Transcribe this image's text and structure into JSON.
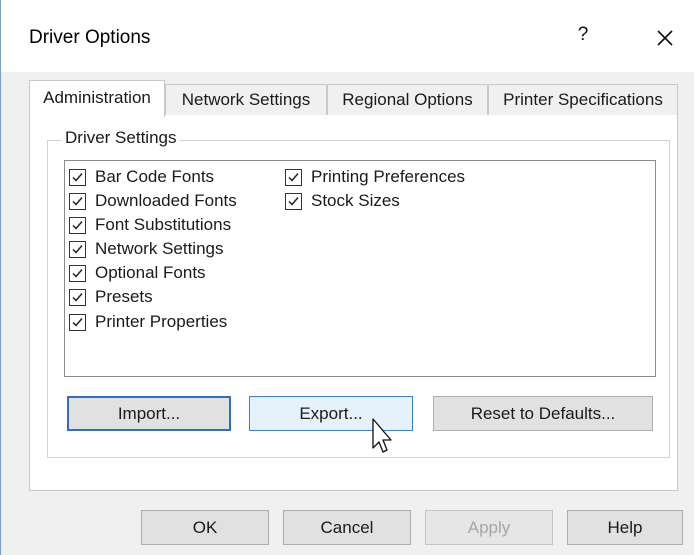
{
  "window": {
    "title": "Driver Options",
    "help_glyph": "?"
  },
  "tabs": [
    {
      "label": "Administration",
      "active": true
    },
    {
      "label": "Network Settings",
      "active": false
    },
    {
      "label": "Regional Options",
      "active": false
    },
    {
      "label": "Printer Specifications",
      "active": false
    }
  ],
  "driver_settings": {
    "label": "Driver Settings",
    "items": [
      {
        "label": "Bar Code Fonts",
        "checked": true
      },
      {
        "label": "Downloaded Fonts",
        "checked": true
      },
      {
        "label": "Font Substitutions",
        "checked": true
      },
      {
        "label": "Network Settings",
        "checked": true
      },
      {
        "label": "Optional Fonts",
        "checked": true
      },
      {
        "label": "Presets",
        "checked": true
      },
      {
        "label": "Printer Properties",
        "checked": true
      },
      {
        "label": "Printing Preferences",
        "checked": true
      },
      {
        "label": "Stock Sizes",
        "checked": true
      }
    ]
  },
  "actions": {
    "import_label": "Import...",
    "export_label": "Export...",
    "reset_label": "Reset to Defaults..."
  },
  "footer": {
    "ok_label": "OK",
    "cancel_label": "Cancel",
    "apply_label": "Apply",
    "help_label": "Help"
  },
  "colors": {
    "accent": "#2f6ec4",
    "hover_fill": "#e5f1fb",
    "dialog_bg": "#f0f0f0"
  }
}
